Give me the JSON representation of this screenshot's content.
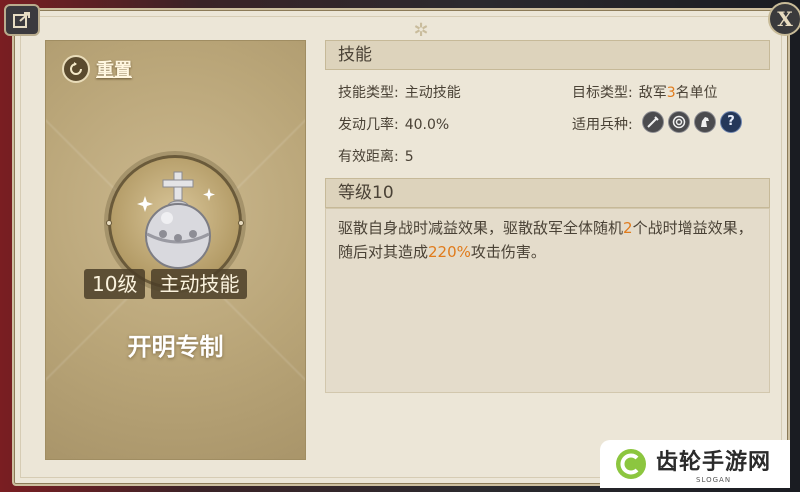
{
  "left_card": {
    "reset_label": "重置",
    "skill_level": "10级",
    "skill_type_badge": "主动技能",
    "exclusive_label": "开明专制"
  },
  "skill_section": {
    "header": "技能",
    "skill_type_key": "技能类型:",
    "skill_type_value": "主动技能",
    "target_type_key": "目标类型:",
    "target_prefix": "敌军",
    "target_count": "3",
    "target_suffix": "名单位",
    "trigger_rate_key": "发动几率:",
    "trigger_rate_value": "40.0%",
    "unit_types_key": "适用兵种:",
    "unit_type_icons": [
      "sword-icon",
      "archer-target-icon",
      "cavalry-horse-icon",
      "help-icon"
    ],
    "range_key": "有效距离:",
    "range_value": "5"
  },
  "level_section": {
    "header": "等级10",
    "desc_part1": "驱散自身战时减益效果，驱散敌军全体随机",
    "desc_num1": "2",
    "desc_part2": "个战时增益效果，随后对其造成",
    "desc_pct": "220%",
    "desc_part3": "攻击伤害。"
  },
  "colors": {
    "highlight": "#e07b1c",
    "text": "#4a4236",
    "card_bg": "#b9a578"
  },
  "watermark": {
    "title": "齿轮手游网",
    "slogan": "SLOGAN"
  }
}
